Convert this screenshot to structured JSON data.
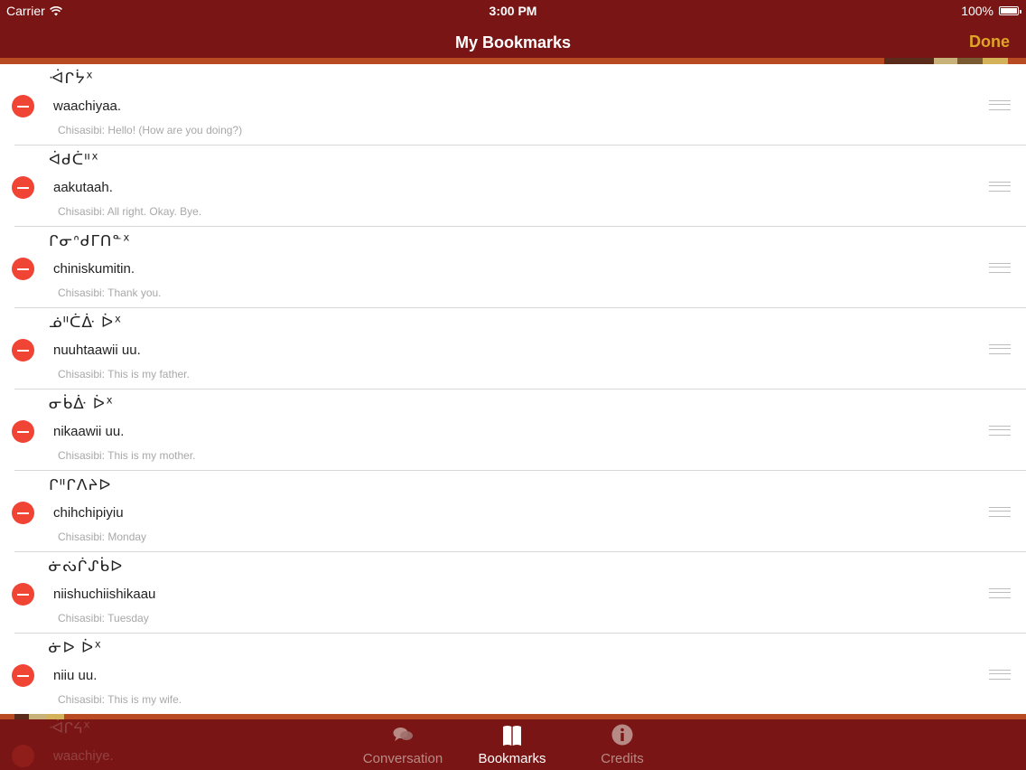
{
  "status_bar": {
    "carrier": "Carrier",
    "time": "3:00 PM",
    "battery": "100%"
  },
  "nav": {
    "title": "My Bookmarks",
    "done_label": "Done"
  },
  "colors": {
    "nav_background": "#7a1515",
    "accent_strip": "#b84b22",
    "done_color": "#e0a526",
    "delete_red": "#f04434"
  },
  "bookmarks": [
    {
      "syllabic": "ᐙᒋᔮᕽ",
      "roman": "waachiyaa.",
      "translation": "Chisasibi: Hello! (How are you doing?)"
    },
    {
      "syllabic": "ᐋᑯᑖᐦᕽ",
      "roman": "aakutaah.",
      "translation": "Chisasibi: All right. Okay. Bye."
    },
    {
      "syllabic": "ᒋᓂᐢᑯᒥᑎᓐᕽ",
      "roman": "chiniskumitin.",
      "translation": "Chisasibi: Thank you."
    },
    {
      "syllabic": "ᓅᐦᑖᐑ  ᐆᕽ",
      "roman": "nuuhtaawii uu.",
      "translation": "Chisasibi: This is my father."
    },
    {
      "syllabic": "ᓂᑳᐑ  ᐆᕽ",
      "roman": "nikaawii uu.",
      "translation": "Chisasibi: This is my mother."
    },
    {
      "syllabic": "ᒋᐦᒋᐱᔨᐅ",
      "roman": "chihchipiyiu",
      "translation": "Chisasibi: Monday"
    },
    {
      "syllabic": "ᓃᔔᒌᔑᑳᐅ",
      "roman": "niishuchiishikaau",
      "translation": "Chisasibi: Tuesday"
    },
    {
      "syllabic": "ᓃᐅ  ᐆᕽ",
      "roman": "niiu uu.",
      "translation": "Chisasibi: This is my wife."
    }
  ],
  "ghost_row": {
    "syllabic": "ᐙᒋᔦᕽ",
    "roman": "waachiye."
  },
  "tabs": [
    {
      "label": "Conversation",
      "icon": "chat-bubbles-icon"
    },
    {
      "label": "Bookmarks",
      "icon": "book-icon"
    },
    {
      "label": "Credits",
      "icon": "info-icon"
    }
  ]
}
